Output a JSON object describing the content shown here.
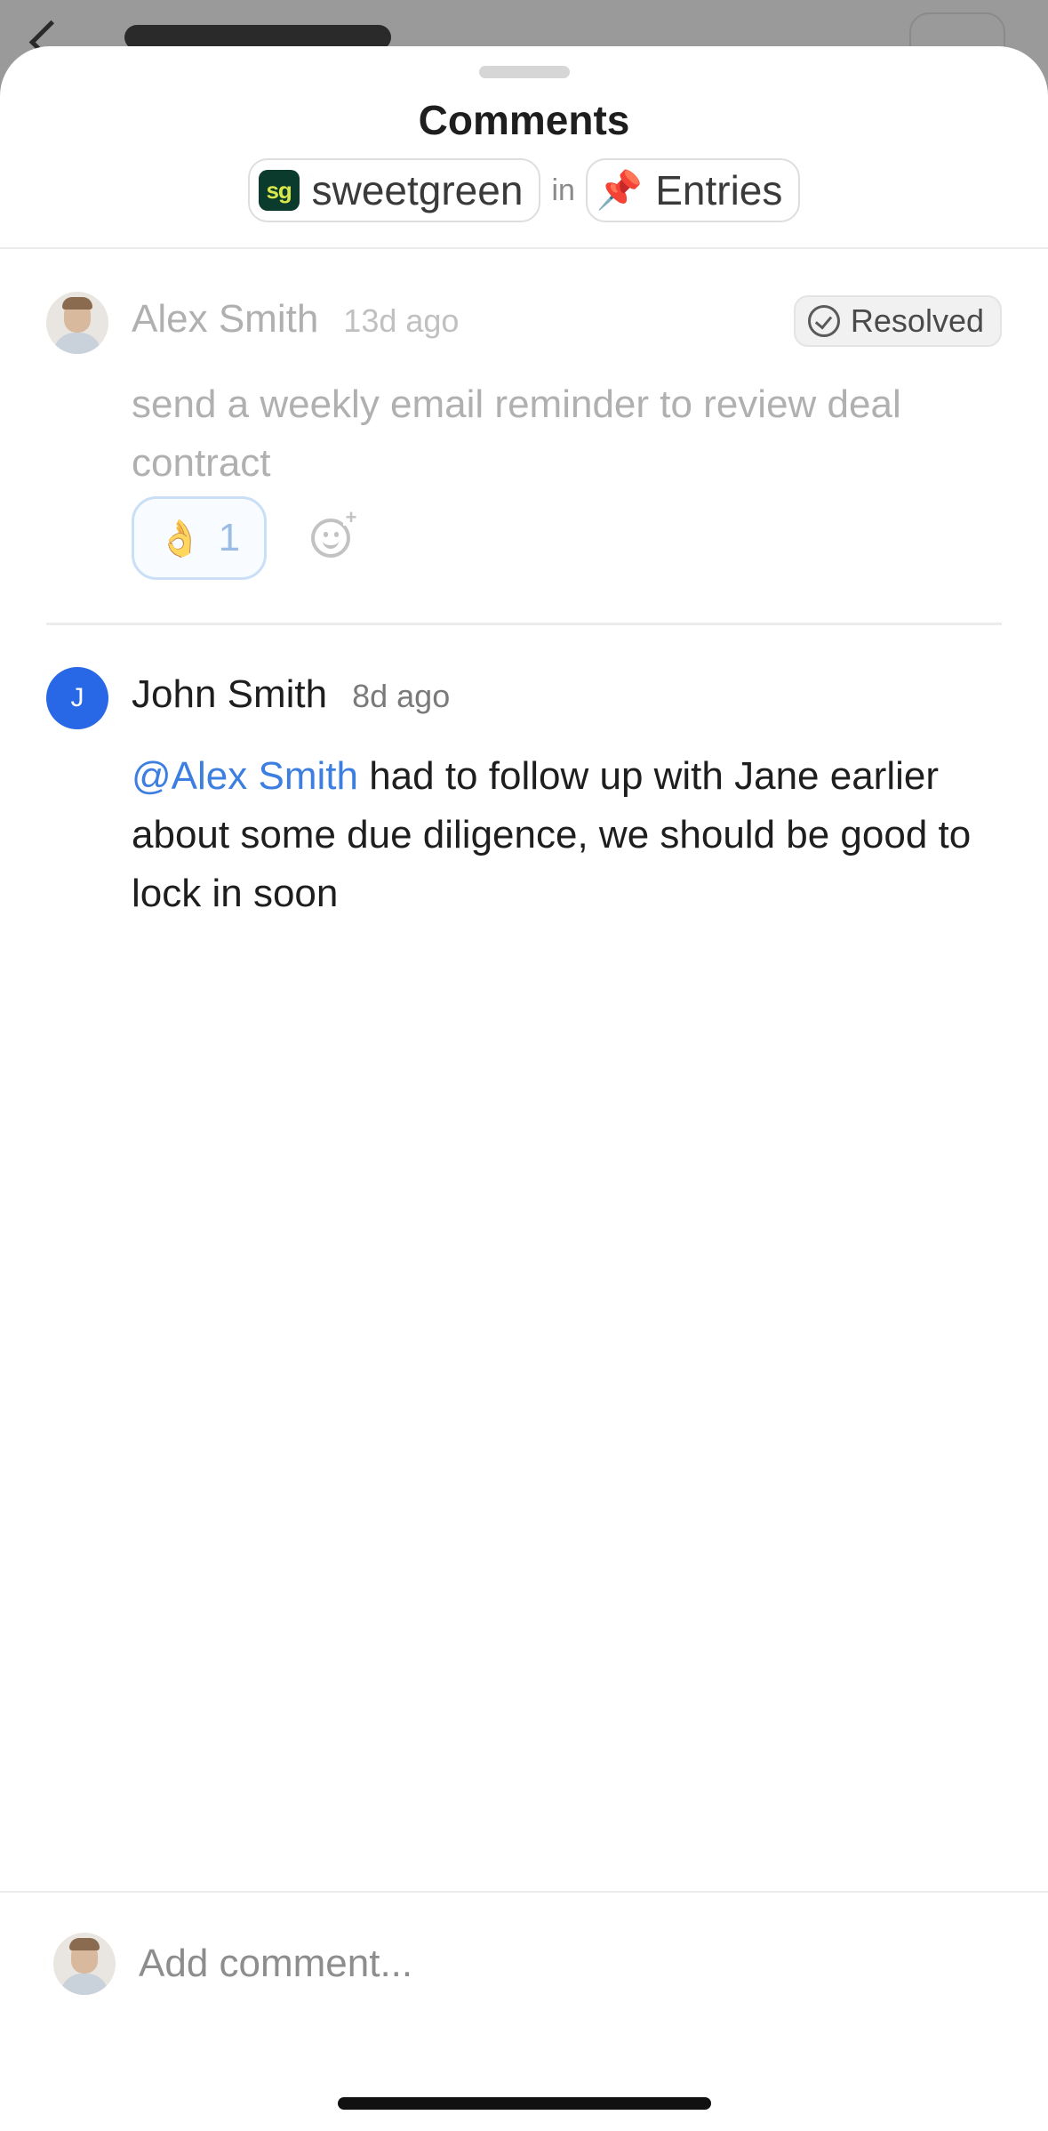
{
  "sheet": {
    "title": "Comments",
    "context": {
      "company": {
        "logo_text": "sg",
        "name": "sweetgreen"
      },
      "connector": "in",
      "list": {
        "icon": "pin-icon",
        "name": "Entries"
      }
    }
  },
  "comments": [
    {
      "author": "Alex Smith",
      "time": "13d ago",
      "status": "Resolved",
      "text": "send a weekly email reminder to review deal contract",
      "reactions": [
        {
          "emoji": "👌",
          "count": "1"
        }
      ]
    },
    {
      "author": "John Smith",
      "avatar_initial": "J",
      "time": "8d ago",
      "mention": "@Alex Smith",
      "text": " had to follow up with Jane earlier about some due diligence, we should be good to lock in soon"
    }
  ],
  "composer": {
    "placeholder": "Add comment..."
  },
  "colors": {
    "mention": "#3d7fe0",
    "avatar_blue": "#2867e6",
    "reaction_border": "#b9d3f3"
  }
}
